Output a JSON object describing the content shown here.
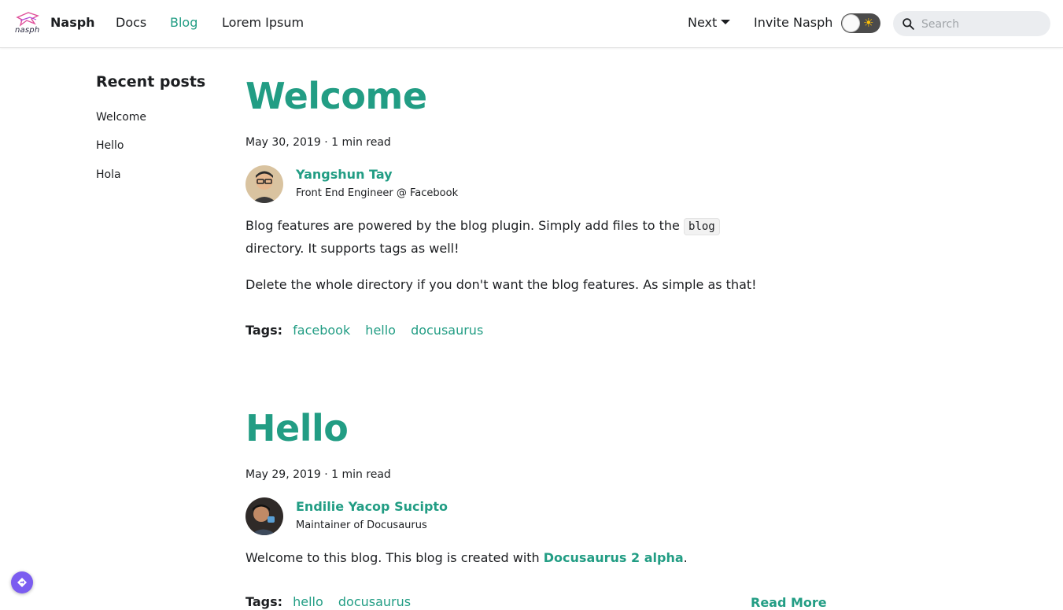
{
  "navbar": {
    "logo_text": "nasph",
    "brand": "Nasph",
    "links": [
      {
        "label": "Docs"
      },
      {
        "label": "Blog"
      },
      {
        "label": "Lorem Ipsum"
      }
    ],
    "version_dropdown": "Next",
    "invite": "Invite Nasph",
    "search_placeholder": "Search",
    "search_value": ""
  },
  "sidebar": {
    "title": "Recent posts",
    "items": [
      {
        "label": "Welcome"
      },
      {
        "label": "Hello"
      },
      {
        "label": "Hola"
      }
    ]
  },
  "posts": [
    {
      "title": "Welcome",
      "meta": "May 30, 2019 · 1 min read",
      "author_name": "Yangshun Tay",
      "author_title": "Front End Engineer @ Facebook",
      "body1_before": "Blog features are powered by the blog plugin. Simply add files to the ",
      "body1_code": "blog",
      "body1_after": " directory. It supports tags as well!",
      "body2": "Delete the whole directory if you don't want the blog features. As simple as that!",
      "tags_label": "Tags:",
      "tags": [
        "facebook",
        "hello",
        "docusaurus"
      ]
    },
    {
      "title": "Hello",
      "meta": "May 29, 2019 · 1 min read",
      "author_name": "Endilie Yacop Sucipto",
      "author_title": "Maintainer of Docusaurus",
      "body_before": "Welcome to this blog. This blog is created with ",
      "body_link": "Docusaurus 2 alpha",
      "body_after": ".",
      "tags_label": "Tags:",
      "tags": [
        "hello",
        "docusaurus"
      ],
      "read_more": "Read More"
    }
  ],
  "colors": {
    "accent": "#229d84",
    "text": "#1c1e21",
    "fab": "#7b5cf0"
  }
}
